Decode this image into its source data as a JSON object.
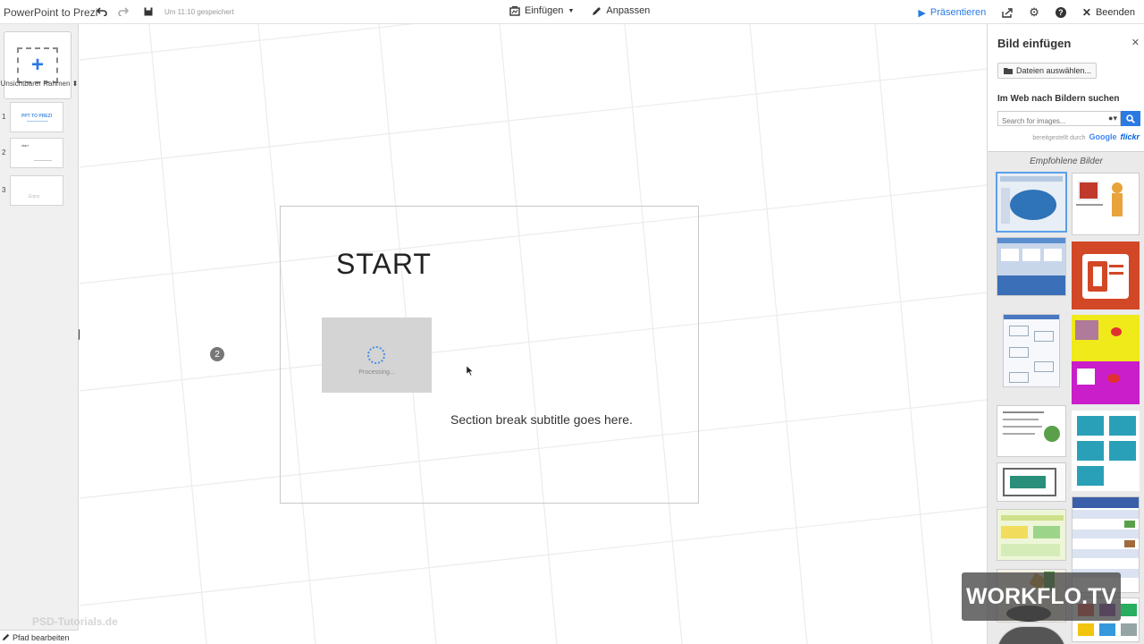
{
  "app": {
    "title": "PowerPoint to Prezi",
    "saved_status": "Um 11:10 gespeichert"
  },
  "toolbar": {
    "insert_label": "Einfügen",
    "customize_label": "Anpassen",
    "present_label": "Präsentieren",
    "exit_label": "Beenden"
  },
  "left_panel": {
    "frame_type": "Unsichtbarer Rahmen",
    "thumbnails": [
      {
        "number": "1",
        "text": "PPT TO PREZI"
      },
      {
        "number": "2",
        "text": "start"
      },
      {
        "number": "3",
        "text": "Enjoy"
      }
    ],
    "path_edit_label": "Pfad bearbeiten"
  },
  "canvas": {
    "frame_title": "START",
    "processing_label": "Processing...",
    "subtitle": "Section break subtitle goes here.",
    "step_badge": "2"
  },
  "right_panel": {
    "title": "Bild einfügen",
    "select_files_label": "Dateien auswählen...",
    "web_search_title": "Im Web nach Bildern suchen",
    "search_placeholder": "Search for images...",
    "powered_by": "bereitgestellt durch",
    "google_label": "Google",
    "flickr_label": "flickr",
    "recommended_title": "Empfohlene Bilder"
  },
  "watermarks": {
    "workflo": "WORKFLO.TV",
    "psd": "PSD-Tutorials.de"
  },
  "colors": {
    "accent": "#2a7ae2",
    "powerpoint_red": "#d24726"
  }
}
